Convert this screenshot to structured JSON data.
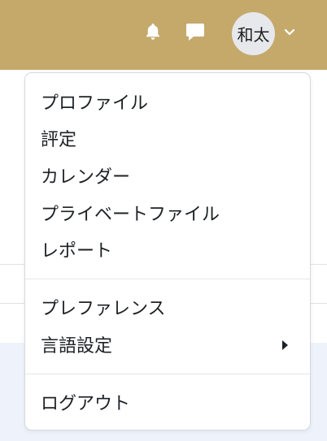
{
  "header": {
    "avatar_text": "和太",
    "icons": [
      "bell-icon",
      "chat-icon",
      "chevron-down-icon"
    ]
  },
  "menu": {
    "items": [
      {
        "label": "プロファイル"
      },
      {
        "label": "評定"
      },
      {
        "label": "カレンダー"
      },
      {
        "label": "プライベートファイル"
      },
      {
        "label": "レポート"
      },
      {
        "label": "プレファレンス"
      },
      {
        "label": "言語設定",
        "submenu_icon": "caret-right-icon"
      },
      {
        "label": "ログアウト"
      }
    ]
  },
  "colors": {
    "header_bg": "#c4a96b",
    "avatar_bg": "#e7e8ec",
    "text": "#1d2125"
  }
}
